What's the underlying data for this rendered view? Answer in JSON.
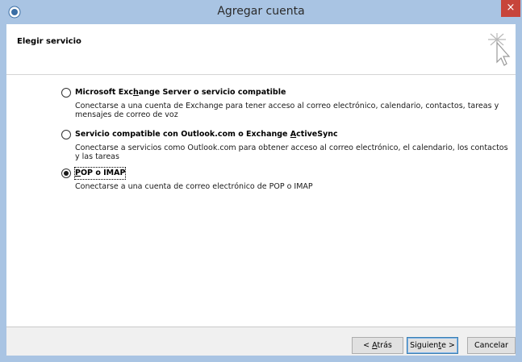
{
  "window": {
    "title": "Agregar cuenta",
    "close_glyph": "×",
    "app_icon": "outlook-app-icon"
  },
  "header": {
    "title": "Elegir servicio",
    "icon": "wizard-cursor-sparkle-icon"
  },
  "options": [
    {
      "label_pre": "Microsoft Exc",
      "label_key": "h",
      "label_post": "ange Server o servicio compatible",
      "description": "Conectarse a una cuenta de Exchange para tener acceso al correo electrónico, calendario, contactos, tareas y mensajes de correo de voz",
      "selected": false
    },
    {
      "label_pre": "Servicio compatible con Outlook.com o Exchange ",
      "label_key": "A",
      "label_post": "ctiveSync",
      "description": "Conectarse a servicios como Outlook.com para obtener acceso al correo electrónico, el calendario, los contactos y las tareas",
      "selected": false
    },
    {
      "label_pre": "",
      "label_key": "P",
      "label_post": "OP o IMAP",
      "description": "Conectarse a una cuenta de correo electrónico de POP o IMAP",
      "selected": true
    }
  ],
  "footer": {
    "back_pre": "< ",
    "back_key": "A",
    "back_post": "trás",
    "next_pre": "Siguien",
    "next_key": "t",
    "next_post": "e >",
    "cancel_label": "Cancelar"
  }
}
